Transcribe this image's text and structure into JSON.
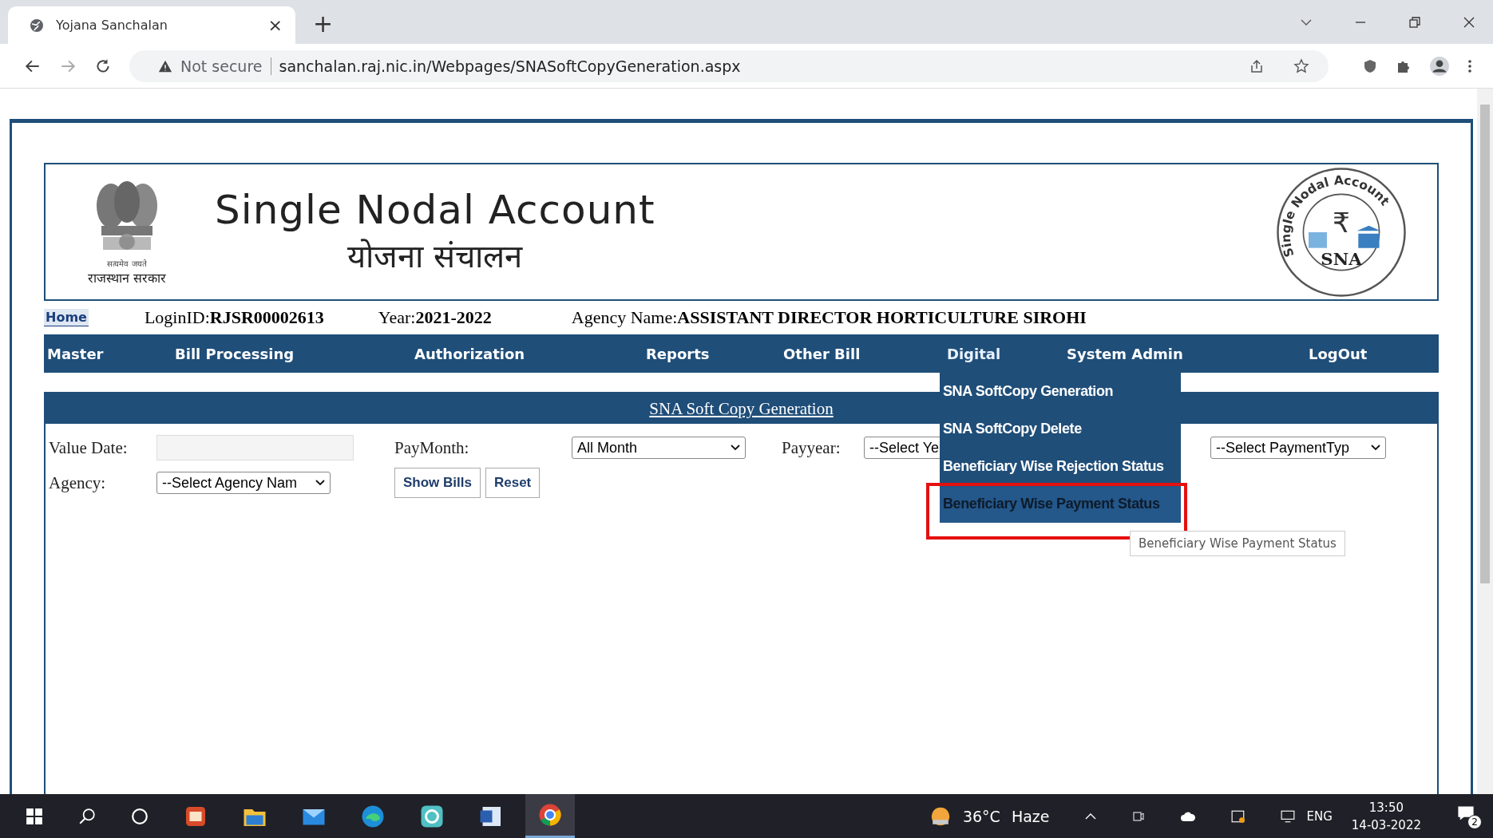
{
  "browser": {
    "tab_title": "Yojana Sanchalan",
    "tab_close": "×",
    "new_tab": "+",
    "security": "Not secure",
    "url": "sanchalan.raj.nic.in/Webpages/SNASoftCopyGeneration.aspx"
  },
  "header": {
    "title": "Single Nodal Account",
    "subtitle": "योजना संचालन",
    "emblem_motto": "सत्यमेव जयते",
    "emblem_caption": "राजस्थान सरकार",
    "logo_ring": "Single Nodal Account",
    "logo_symbol": "₹",
    "logo_text": "SNA"
  },
  "info": {
    "home": "Home",
    "fields": [
      {
        "label": "LoginID:",
        "value": "RJSR00002613"
      },
      {
        "label": "Year:",
        "value": "2021-2022"
      },
      {
        "label": "Agency Name:",
        "value": "ASSISTANT DIRECTOR HORTICULTURE SIROHI"
      }
    ]
  },
  "nav": [
    {
      "label": "Master",
      "expanded": false
    },
    {
      "label": "Bill Processing",
      "expanded": false
    },
    {
      "label": "Authorization",
      "expanded": false
    },
    {
      "label": "Reports",
      "expanded": false
    },
    {
      "label": "Other Bill",
      "expanded": false
    },
    {
      "label": "Digital",
      "expanded": true
    },
    {
      "label": "System Admin",
      "expanded": false
    },
    {
      "label": "LogOut",
      "expanded": false
    }
  ],
  "menu": [
    {
      "label": "SNA SoftCopy Generation",
      "selected": false,
      "marked": false
    },
    {
      "label": "SNA SoftCopy Delete",
      "selected": false,
      "marked": false
    },
    {
      "label": "Beneficiary Wise Rejection Status",
      "selected": false,
      "marked": false
    },
    {
      "label": "Beneficiary Wise Payment Status",
      "selected": true,
      "marked": true
    }
  ],
  "tooltip": "Beneficiary Wise Payment Status",
  "panel": {
    "title": "SNA Soft Copy Generation"
  },
  "form": {
    "value_date": {
      "label": "Value Date:"
    },
    "pay_month": {
      "label": "PayMonth:",
      "value": "All Month"
    },
    "pay_year": {
      "label": "Payyear:",
      "value": "--Select Ye"
    },
    "payment_type": {
      "value": "--Select PaymentTyp"
    },
    "agency": {
      "label": "Agency:",
      "value": "--Select Agency Nam"
    },
    "buttons": [
      "Show Bills",
      "Reset"
    ]
  },
  "taskbar": {
    "weather": "36°C",
    "condition": "Haze",
    "language": "ENG",
    "time": "13:50",
    "date": "14-03-2022",
    "notifications": "2"
  }
}
